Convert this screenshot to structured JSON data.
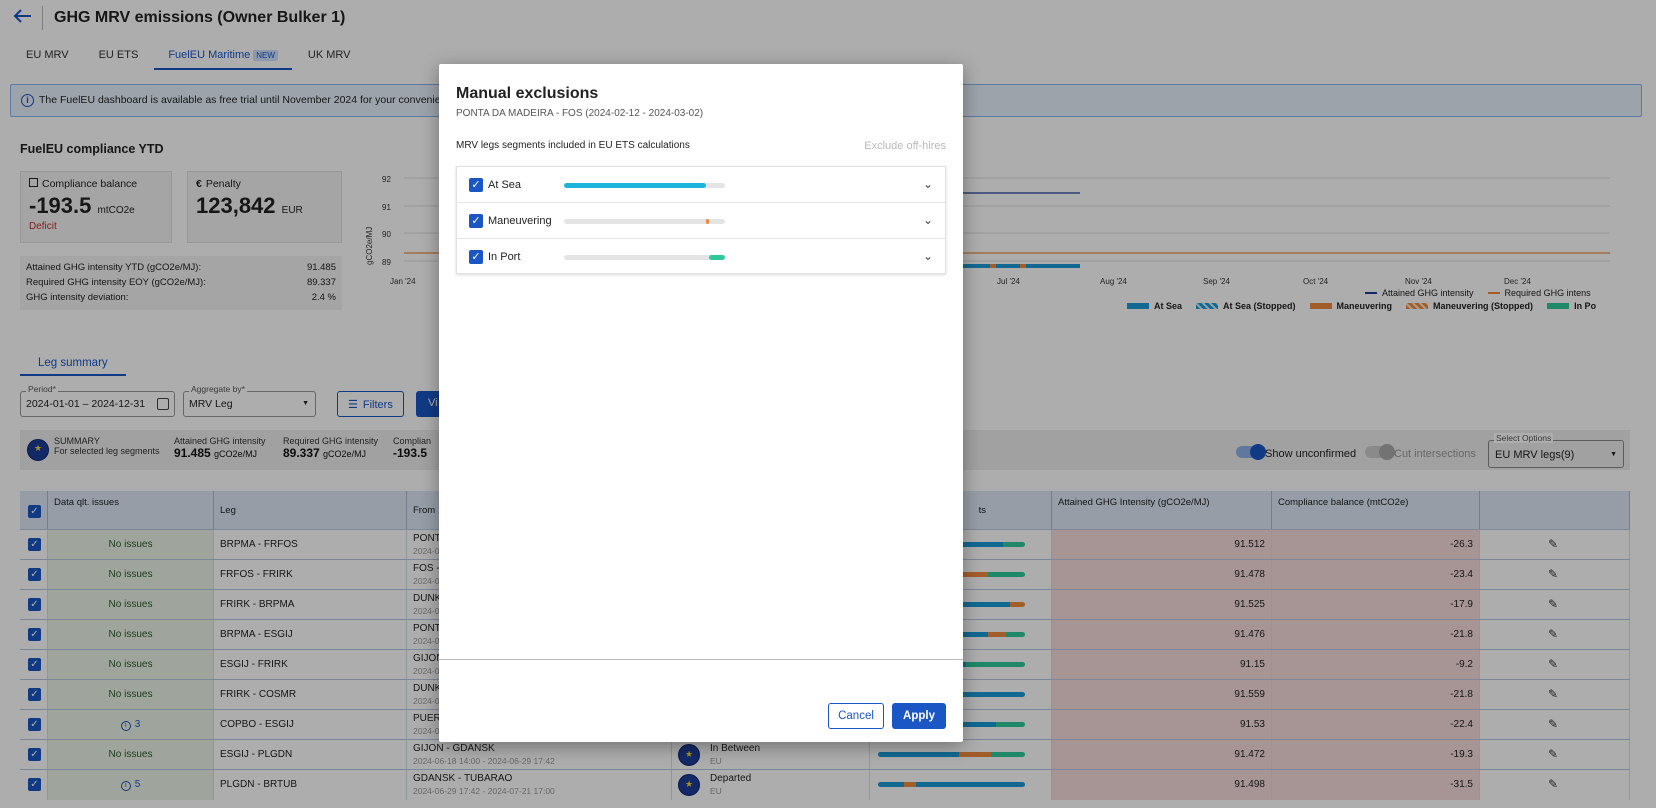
{
  "header": {
    "title": "GHG MRV emissions (Owner Bulker 1)",
    "back_icon": "arrow-left-icon"
  },
  "tabs": [
    {
      "label": "EU MRV",
      "active": false
    },
    {
      "label": "EU ETS",
      "active": false
    },
    {
      "label": "FuelEU Maritime",
      "badge": "NEW",
      "active": true
    },
    {
      "label": "UK MRV",
      "active": false
    }
  ],
  "banner": {
    "text": "The FuelEU dashboard is available as free trial until November 2024 for your convenien"
  },
  "compliance": {
    "title": "FuelEU compliance YTD",
    "balance": {
      "label": "Compliance balance",
      "value": "-193.5",
      "unit": "mtCO2e",
      "status": "Deficit"
    },
    "penalty": {
      "label": "Penalty",
      "value": "123,842",
      "unit": "EUR",
      "icon": "euro-icon"
    },
    "ghg": [
      {
        "label": "Attained GHG intensity YTD (gCO2e/MJ):",
        "value": "91.485"
      },
      {
        "label": "Required GHG intensity EOY (gCO2e/MJ):",
        "value": "89.337"
      },
      {
        "label": "GHG intensity deviation:",
        "value": "2.4 %"
      }
    ]
  },
  "chart": {
    "ylabel": "gCO2e/MJ",
    "yticks": [
      "92",
      "91",
      "90",
      "89"
    ],
    "xticks": [
      "Jan '24",
      "Jul '24",
      "Aug '24",
      "Sep '24",
      "Oct '24",
      "Nov '24",
      "Dec '24"
    ],
    "legend_lines": [
      "Attained GHG intensity",
      "Required GHG intens"
    ],
    "legend_bars": [
      "At Sea",
      "At Sea (Stopped)",
      "Maneuvering",
      "Maneuvering (Stopped)",
      "In Po"
    ]
  },
  "leg_summary": {
    "tab": "Leg summary",
    "period_label": "Period*",
    "period_value": "2024-01-01 – 2024-12-31",
    "aggregate_label": "Aggregate by*",
    "aggregate_value": "MRV Leg",
    "filters_label": "Filters",
    "view_label": "Vi",
    "summary": {
      "title": "SUMMARY",
      "subtitle": "For selected leg segments",
      "attained_label": "Attained GHG intensity",
      "attained_value": "91.485",
      "attained_unit": "gCO2e/MJ",
      "required_label": "Required GHG intensity",
      "required_value": "89.337",
      "required_unit": "gCO2e/MJ",
      "compliance_label": "Complian",
      "compliance_value": "-193.5"
    },
    "show_unconfirmed": "Show unconfirmed",
    "cut_intersections": "Cut intersections",
    "select_options_label": "Select Options",
    "select_options_value": "EU MRV legs(9)"
  },
  "table": {
    "headers": {
      "quality": "Data qlt. issues",
      "leg": "Leg",
      "from": "From",
      "segments": "ts",
      "attained": "Attained GHG Intensity (gCO2e/MJ)",
      "balance": "Compliance balance (mtCO2e)"
    },
    "rows": [
      {
        "quality": "No issues",
        "leg": "BRPMA - FRFOS",
        "from": "PONT",
        "sub": "2024-0",
        "status": "",
        "status_sub": "",
        "attained": "91.512",
        "balance": "-26.3"
      },
      {
        "quality": "No issues",
        "leg": "FRFOS - FRIRK",
        "from": "FOS -",
        "sub": "2024-0",
        "status": "",
        "status_sub": "",
        "attained": "91.478",
        "balance": "-23.4"
      },
      {
        "quality": "No issues",
        "leg": "FRIRK - BRPMA",
        "from": "DUNK",
        "sub": "2024-0",
        "status": "",
        "status_sub": "",
        "attained": "91.525",
        "balance": "-17.9"
      },
      {
        "quality": "No issues",
        "leg": "BRPMA - ESGIJ",
        "from": "PONT",
        "sub": "2024-0",
        "status": "",
        "status_sub": "",
        "attained": "91.476",
        "balance": "-21.8"
      },
      {
        "quality": "No issues",
        "leg": "ESGIJ - FRIRK",
        "from": "GIJON",
        "sub": "2024-0",
        "status": "",
        "status_sub": "",
        "attained": "91.15",
        "balance": "-9.2"
      },
      {
        "quality": "No issues",
        "leg": "FRIRK - COSMR",
        "from": "DUNK",
        "sub": "2024-0",
        "status": "",
        "status_sub": "",
        "attained": "91.559",
        "balance": "-21.8"
      },
      {
        "quality": "3",
        "leg": "COPBO - ESGIJ",
        "from": "PUER",
        "sub": "2024-0",
        "status": "",
        "status_sub": "",
        "attained": "91.53",
        "balance": "-22.4"
      },
      {
        "quality": "No issues",
        "leg": "ESGIJ - PLGDN",
        "from": "GIJON - GDANSK",
        "sub": "2024-06-18 14:00 - 2024-06-29 17:42",
        "status": "In Between",
        "status_sub": "EU",
        "attained": "91.472",
        "balance": "-19.3"
      },
      {
        "quality": "5",
        "leg": "PLGDN - BRTUB",
        "from": "GDANSK - TUBARAO",
        "sub": "2024-06-29 17:42 - 2024-07-21 17:00",
        "status": "Departed",
        "status_sub": "EU",
        "attained": "91.498",
        "balance": "-31.5"
      }
    ]
  },
  "modal": {
    "title": "Manual exclusions",
    "subtitle": "PONTA DA MADEIRA - FOS (2024-02-12 - 2024-03-02)",
    "section_label": "MRV legs segments included in EU ETS calculations",
    "exclude_link": "Exclude off-hires",
    "segments": [
      {
        "label": "At Sea",
        "checked": true,
        "fill_start": 0.0,
        "fill_end": 0.88,
        "color": "#1ab4dc"
      },
      {
        "label": "Maneuvering",
        "checked": true,
        "fill_start": 0.88,
        "fill_end": 0.9,
        "color": "#f08a3c"
      },
      {
        "label": "In Port",
        "checked": true,
        "fill_start": 0.9,
        "fill_end": 1.0,
        "color": "#2ec99b"
      }
    ],
    "cancel_label": "Cancel",
    "apply_label": "Apply"
  },
  "colors": {
    "accent": "#1a56c4",
    "at_sea": "#1ab4dc",
    "maneuvering": "#f08a3c",
    "in_port": "#2ec99b",
    "deficit": "#c0302a"
  }
}
